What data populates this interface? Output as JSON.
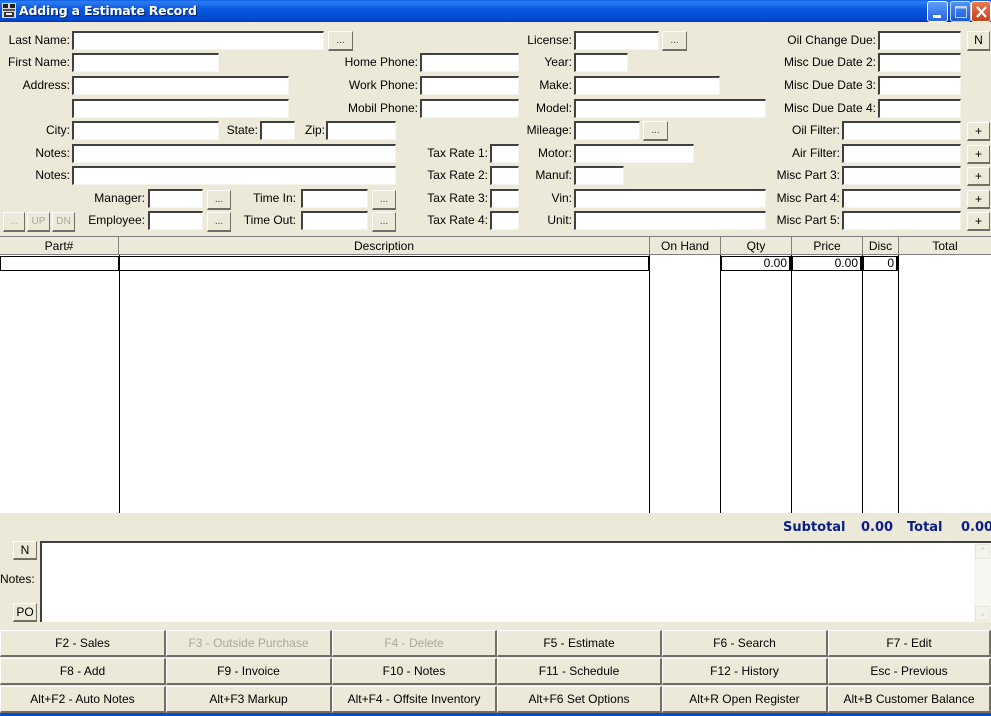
{
  "window": {
    "title": "Adding a Estimate Record",
    "icon": "app-icon",
    "controls": [
      "minimize",
      "maximize",
      "close"
    ]
  },
  "customer": {
    "last_name_label": "Last Name:",
    "last_name": "",
    "first_name_label": "First Name:",
    "first_name": "",
    "address_label": "Address:",
    "address1": "",
    "address2": "",
    "city_label": "City:",
    "city": "",
    "state_label": "State:",
    "state": "",
    "zip_label": "Zip:",
    "zip": "",
    "notes1_label": "Notes:",
    "notes1": "",
    "notes2_label": "Notes:",
    "notes2": "",
    "home_phone_label": "Home Phone:",
    "home_phone": "",
    "work_phone_label": "Work Phone:",
    "work_phone": "",
    "mobil_phone_label": "Mobil Phone:",
    "mobil_phone": "",
    "lookup_button": "..."
  },
  "staff": {
    "manager_label": "Manager:",
    "manager": "",
    "employee_label": "Employee:",
    "employee": "",
    "time_in_label": "Time In:",
    "time_in": "",
    "time_out_label": "Time Out:",
    "time_out": "",
    "lookup_button": "..."
  },
  "nav_buttons": {
    "dots": "...",
    "up": "UP",
    "dn": "DN"
  },
  "tax": {
    "rate1_label": "Tax Rate 1:",
    "rate1": "",
    "rate2_label": "Tax Rate 2:",
    "rate2": "",
    "rate3_label": "Tax Rate 3:",
    "rate3": "",
    "rate4_label": "Tax Rate 4:",
    "rate4": ""
  },
  "vehicle": {
    "license_label": "License:",
    "license": "",
    "year_label": "Year:",
    "year": "",
    "make_label": "Make:",
    "make": "",
    "model_label": "Model:",
    "model": "",
    "mileage_label": "Mileage:",
    "mileage": "",
    "motor_label": "Motor:",
    "motor": "",
    "manuf_label": "Manuf:",
    "manuf": "",
    "vin_label": "Vin:",
    "vin": "",
    "unit_label": "Unit:",
    "unit": "",
    "lookup_button": "..."
  },
  "maintenance": {
    "oil_change_due_label": "Oil Change Due:",
    "oil_change_due": "",
    "misc_due2_label": "Misc Due Date 2:",
    "misc_due2": "",
    "misc_due3_label": "Misc Due Date 3:",
    "misc_due3": "",
    "misc_due4_label": "Misc Due Date 4:",
    "misc_due4": "",
    "oil_filter_label": "Oil Filter:",
    "oil_filter": "",
    "air_filter_label": "Air Filter:",
    "air_filter": "",
    "misc_part3_label": "Misc Part 3:",
    "misc_part3": "",
    "misc_part4_label": "Misc Part 4:",
    "misc_part4": "",
    "misc_part5_label": "Misc Part 5:",
    "misc_part5": "",
    "n_button": "N",
    "plus_button": "+"
  },
  "grid": {
    "columns": [
      "Part#",
      "Description",
      "On Hand",
      "Qty",
      "Price",
      "Disc",
      "Total"
    ],
    "rows": [
      {
        "part": "",
        "description": "",
        "on_hand": "",
        "qty": "0.00",
        "price": "0.00",
        "disc": "0",
        "total": ""
      }
    ]
  },
  "totals": {
    "subtotal_label": "Subtotal",
    "subtotal": "0.00",
    "total_label": "Total",
    "total": "0.00"
  },
  "notes": {
    "label": "Notes:",
    "value": "",
    "n_button": "N",
    "po_button": "PO"
  },
  "function_keys": [
    [
      {
        "label": "F2 - Sales",
        "enabled": true
      },
      {
        "label": "F3 - Outside Purchase",
        "enabled": false
      },
      {
        "label": "F4 - Delete",
        "enabled": false
      },
      {
        "label": "F5 - Estimate",
        "enabled": true
      },
      {
        "label": "F6 - Search",
        "enabled": true
      },
      {
        "label": "F7 - Edit",
        "enabled": true
      }
    ],
    [
      {
        "label": "F8 - Add",
        "enabled": true
      },
      {
        "label": "F9 - Invoice",
        "enabled": true
      },
      {
        "label": "F10 - Notes",
        "enabled": true
      },
      {
        "label": "F11 - Schedule",
        "enabled": true
      },
      {
        "label": "F12 - History",
        "enabled": true
      },
      {
        "label": "Esc - Previous",
        "enabled": true
      }
    ],
    [
      {
        "label": "Alt+F2 - Auto Notes",
        "enabled": true
      },
      {
        "label": "Alt+F3 Markup",
        "enabled": true
      },
      {
        "label": "Alt+F4 - Offsite Inventory",
        "enabled": true
      },
      {
        "label": "Alt+F6 Set Options",
        "enabled": true
      },
      {
        "label": "Alt+R Open Register",
        "enabled": true
      },
      {
        "label": "Alt+B Customer Balance",
        "enabled": true
      }
    ]
  ]
}
